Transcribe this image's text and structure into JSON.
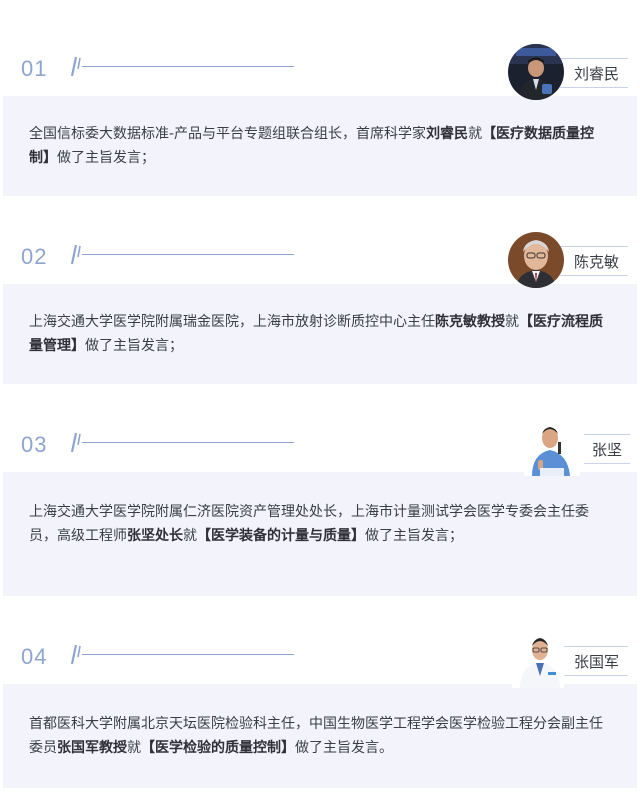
{
  "sections": [
    {
      "num": "01",
      "name": "刘睿民",
      "desc_pre": "全国信标委大数据标准-产品与平台专题组联合组长，首席科学家",
      "desc_bold": "刘睿民",
      "desc_mid": "就",
      "desc_topic": "【医疗数据质量控制】",
      "desc_post": "做了主旨发言；",
      "avatar": "portrait-man-dark-jacket"
    },
    {
      "num": "02",
      "name": "陈克敏",
      "desc_pre": "上海交通大学医学院附属瑞金医院，上海市放射诊断质控中心主任",
      "desc_bold": "陈克敏教授",
      "desc_mid": "就",
      "desc_topic": "【医疗流程质量管理】",
      "desc_post": "做了主旨发言；",
      "avatar": "portrait-man-glasses-suit"
    },
    {
      "num": "03",
      "name": "张坚",
      "desc_pre": "上海交通大学医学院附属仁济医院资产管理处处长，上海市计量测试学会医学专委会主任委员，高级工程师",
      "desc_bold": "张坚处长",
      "desc_mid": "就",
      "desc_topic": "【医学装备的计量与质量】",
      "desc_post": "做了主旨发言；",
      "avatar": "portrait-man-speaking-mic"
    },
    {
      "num": "04",
      "name": "张国军",
      "desc_pre": "首都医科大学附属北京天坛医院检验科主任，中国生物医学工程学会医学检验工程分会副主任委员",
      "desc_bold": "张国军教授",
      "desc_mid": "就",
      "desc_topic": "【医学检验的质量控制】",
      "desc_post": "做了主旨发言。",
      "avatar": "portrait-doctor-white-coat"
    }
  ],
  "colors": {
    "accent": "#8ea5cf",
    "card_bg": "#f3f4fb",
    "text": "#3a3d45"
  }
}
